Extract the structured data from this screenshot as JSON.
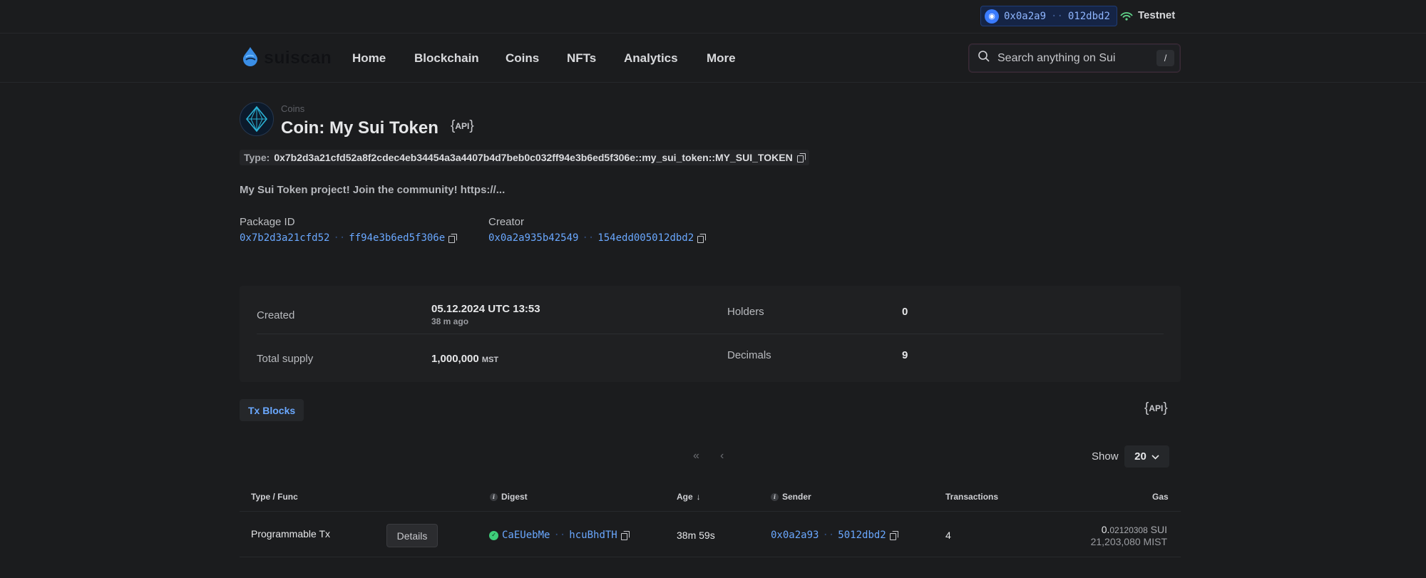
{
  "topbar": {
    "wallet": {
      "address_start": "0x0a2a9",
      "address_end": "012dbd2"
    },
    "network": "Testnet"
  },
  "nav": {
    "logo": "suiscan",
    "items": [
      "Home",
      "Blockchain",
      "Coins",
      "NFTs",
      "Analytics",
      "More"
    ],
    "search_placeholder": "Search anything on Sui",
    "search_shortcut": "/"
  },
  "header": {
    "breadcrumb": "Coins",
    "title": "Coin: My Sui Token",
    "api_label": "API",
    "type_label": "Type:",
    "type_value": "0x7b2d3a21cfd52a8f2cdec4eb34454a3a4407b4d7beb0c032ff94e3b6ed5f306e::my_sui_token::MY_SUI_TOKEN",
    "description": "My Sui Token project! Join the community! https://...",
    "package_id_label": "Package ID",
    "package_id_start": "0x7b2d3a21cfd52",
    "package_id_end": "ff94e3b6ed5f306e",
    "creator_label": "Creator",
    "creator_start": "0x0a2a935b42549",
    "creator_end": "154edd005012dbd2"
  },
  "stats": {
    "created_label": "Created",
    "created_value": "05.12.2024 UTC 13:53",
    "created_ago": "38 m ago",
    "holders_label": "Holders",
    "holders_value": "0",
    "supply_label": "Total supply",
    "supply_value": "1,000,000",
    "supply_unit": "MST",
    "decimals_label": "Decimals",
    "decimals_value": "9"
  },
  "tabs": {
    "tx_blocks": "Tx Blocks",
    "api_label": "API"
  },
  "pagination": {
    "first": "«",
    "prev": "‹",
    "show_label": "Show",
    "page_size": "20"
  },
  "table": {
    "headers": {
      "type": "Type / Func",
      "digest": "Digest",
      "age": "Age",
      "age_sort": "↓",
      "sender": "Sender",
      "transactions": "Transactions",
      "gas": "Gas"
    },
    "rows": [
      {
        "type": "Programmable Tx",
        "details": "Details",
        "digest_start": "CaEUebMe",
        "digest_end": "hcuBhdTH",
        "age": "38m 59s",
        "sender_start": "0x0a2a93",
        "sender_end": "5012dbd2",
        "transactions": "4",
        "gas_int": "0.",
        "gas_dec": "02120308",
        "gas_unit": "SUI",
        "gas_mist": "21,203,080 MIST"
      }
    ]
  }
}
